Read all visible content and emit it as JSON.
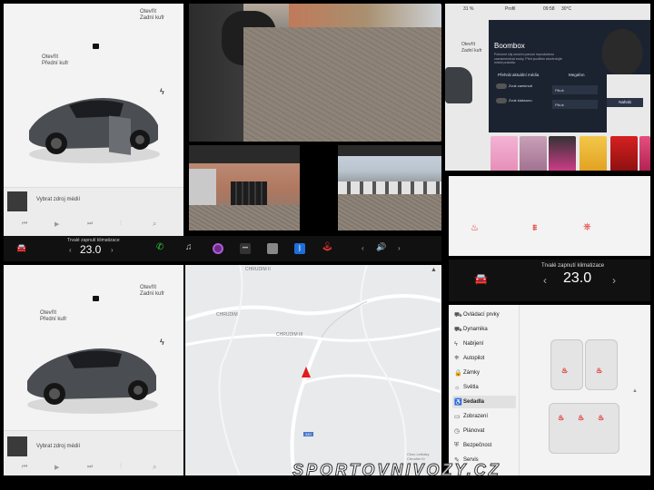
{
  "top_left": {
    "trunk_front": "Otevřít\nPřední kufr",
    "trunk_rear": "Otevřít\nZadní kufr",
    "media_prompt": "Vybrat zdroj médií"
  },
  "taskbar_top": {
    "climate_label": "Trvalé zapnutí klimatizace",
    "temperature": "23.0"
  },
  "boombox": {
    "status_left": "31 %",
    "profile": "Profil",
    "time": "09:58",
    "outside_temp": "30°C",
    "title": "Boombox",
    "description": "Pohonné síly umožní pomocí reproduktoru zaznamenávat zvuky. Před použitím zkontrolujte místní pravidla.",
    "play_media": "Přehrát aktuální média",
    "megafon": "Megafon",
    "lock_sound": "Zvuk zamknutí",
    "horn_sound": "Zvuk klaksonu",
    "select1": "Pikuk",
    "select2": "Pikuk",
    "record": "Nahrát",
    "rear_trunk": "Otevřít\nZadní kufr"
  },
  "climate_panel": {
    "label": "Trvalé zapnutí klimatizace",
    "temperature": "23.0"
  },
  "bottom_left": {
    "trunk_front": "Otevřít\nPřední kufr",
    "trunk_rear": "Otevřít\nZadní kufr",
    "media_prompt": "Vybrat zdroj médií"
  },
  "map": {
    "labels": [
      "CHRUDIM II",
      "CHRUDIM",
      "CHRUDIM III"
    ],
    "road": "340",
    "poi": "Chov Letňáky\nChrudim III"
  },
  "settings_menu": [
    {
      "label": "Ovládací prvky",
      "icon": "car-icon"
    },
    {
      "label": "Dynamika",
      "icon": "car-icon"
    },
    {
      "label": "Nabíjení",
      "icon": "bolt-icon"
    },
    {
      "label": "Autopilot",
      "icon": "steering-icon"
    },
    {
      "label": "Zámky",
      "icon": "lock-icon"
    },
    {
      "label": "Světla",
      "icon": "light-icon"
    },
    {
      "label": "Sedadla",
      "icon": "seat-icon"
    },
    {
      "label": "Zobrazení",
      "icon": "display-icon"
    },
    {
      "label": "Plánovat",
      "icon": "clock-icon"
    },
    {
      "label": "Bezpečnost",
      "icon": "shield-icon"
    },
    {
      "label": "Servis",
      "icon": "wrench-icon"
    }
  ],
  "watermark": "SPORTOVNIVOZY.CZ"
}
